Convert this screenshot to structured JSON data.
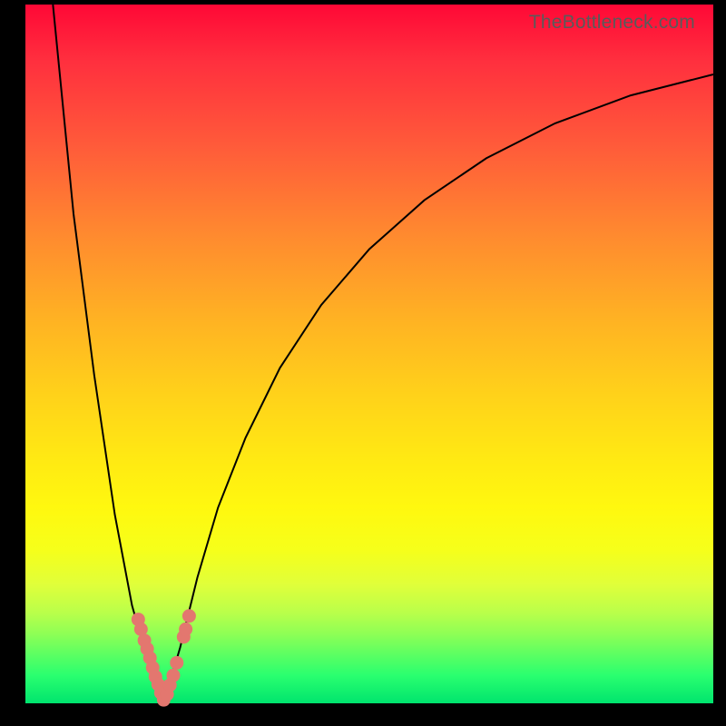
{
  "watermark": "TheBottleneck.com",
  "chart_data": {
    "type": "line",
    "title": "",
    "xlabel": "",
    "ylabel": "",
    "xlim": [
      0,
      100
    ],
    "ylim": [
      0,
      100
    ],
    "grid": false,
    "series": [
      {
        "name": "left-branch",
        "x": [
          4.0,
          7.0,
          10.0,
          13.0,
          15.5,
          17.5,
          18.8,
          19.5,
          20.0
        ],
        "y": [
          100.0,
          70.0,
          47.0,
          27.0,
          14.0,
          7.0,
          3.5,
          1.5,
          0.0
        ]
      },
      {
        "name": "right-branch",
        "x": [
          20.0,
          21.0,
          22.5,
          25.0,
          28.0,
          32.0,
          37.0,
          43.0,
          50.0,
          58.0,
          67.0,
          77.0,
          88.0,
          100.0
        ],
        "y": [
          0.0,
          3.0,
          8.0,
          18.0,
          28.0,
          38.0,
          48.0,
          57.0,
          65.0,
          72.0,
          78.0,
          83.0,
          87.0,
          90.0
        ]
      }
    ],
    "markers": [
      {
        "x": 16.4,
        "y": 12.0
      },
      {
        "x": 16.8,
        "y": 10.6
      },
      {
        "x": 17.3,
        "y": 9.0
      },
      {
        "x": 17.7,
        "y": 7.8
      },
      {
        "x": 18.1,
        "y": 6.5
      },
      {
        "x": 18.5,
        "y": 5.1
      },
      {
        "x": 18.9,
        "y": 3.8
      },
      {
        "x": 19.3,
        "y": 2.7
      },
      {
        "x": 19.7,
        "y": 1.5
      },
      {
        "x": 20.1,
        "y": 0.5
      },
      {
        "x": 20.6,
        "y": 1.3
      },
      {
        "x": 21.0,
        "y": 2.6
      },
      {
        "x": 21.5,
        "y": 4.0
      },
      {
        "x": 22.0,
        "y": 5.8
      },
      {
        "x": 23.0,
        "y": 9.5
      },
      {
        "x": 23.3,
        "y": 10.6
      },
      {
        "x": 23.8,
        "y": 12.5
      }
    ],
    "background_gradient": {
      "top": "#ff0836",
      "bottom": "#00e46e"
    }
  }
}
